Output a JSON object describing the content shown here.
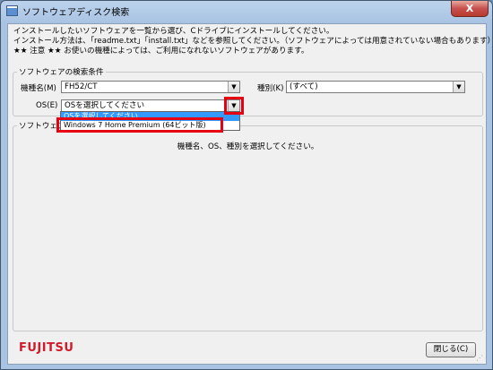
{
  "window": {
    "title": "ソフトウェアディスク検索",
    "close_glyph": "X"
  },
  "intro": {
    "line1": "インストールしたいソフトウェアを一覧から選び、Cドライブにインストールしてください。",
    "line2": "インストール方法は、「readme.txt」「install.txt」などを参照してください。（ソフトウェアによっては用意されていない場合もあります）",
    "line3": "★★ 注意 ★★ お使いの機種によっては、ご利用になれないソフトウェアがあります。"
  },
  "search": {
    "group_title": "ソフトウェアの検索条件",
    "model_label": "機種名(M)",
    "model_value": "FH52/CT",
    "type_label": "種別(K)",
    "type_value": "(すべて)",
    "os_label": "OS(E)",
    "os_value": "OSを選択してください",
    "os_options": [
      "OSを選択してください",
      "Windows 7 Home Premium (64ビット版)"
    ],
    "dropdown_arrow": "▼"
  },
  "software": {
    "group_title": "ソフトウェア",
    "message": "機種名、OS、種別を選択してください。"
  },
  "footer": {
    "logo": "FUJITSU",
    "close_button": "閉じる(C)"
  },
  "colors": {
    "highlight": "#e60012",
    "selection": "#3399ff",
    "logo": "#d11a2a"
  }
}
